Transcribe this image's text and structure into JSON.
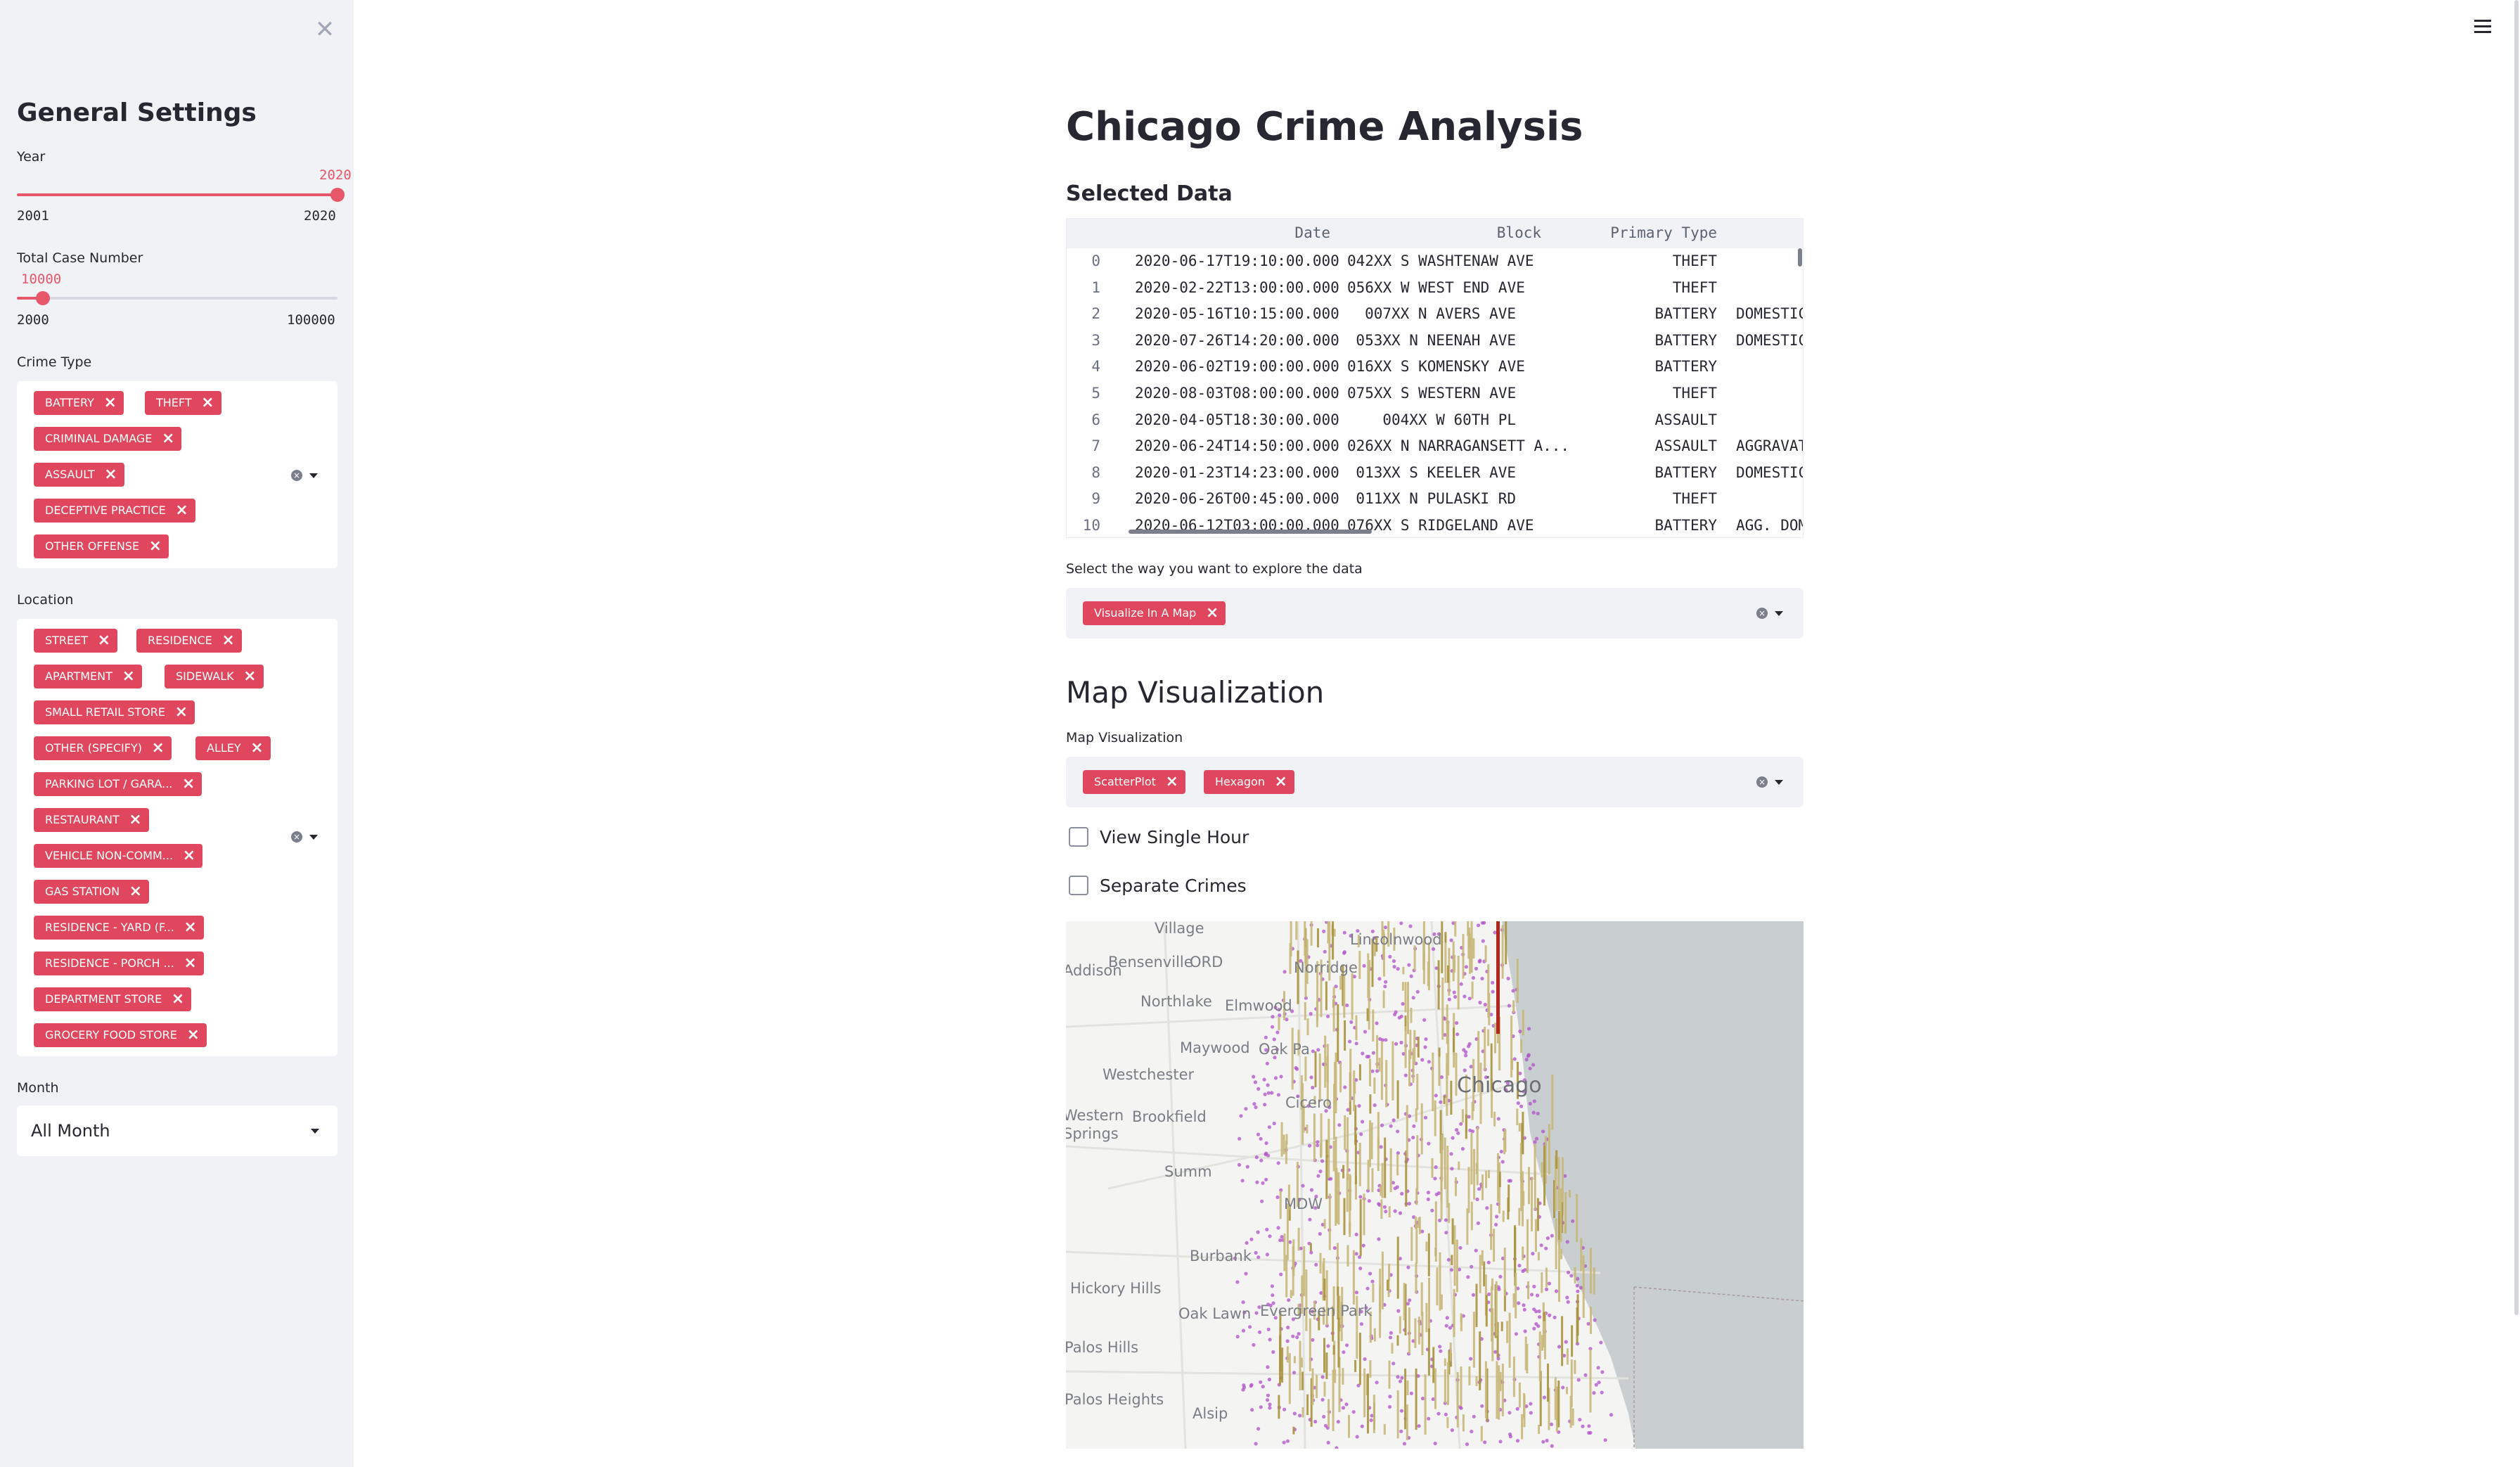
{
  "sidebar": {
    "title": "General Settings",
    "year": {
      "label": "Year",
      "value": "2020",
      "min": "2001",
      "max": "2020",
      "fraction": 1.0
    },
    "total_case": {
      "label": "Total Case Number",
      "value": "10000",
      "min": "2000",
      "max": "100000",
      "fraction": 0.082
    },
    "crime_type": {
      "label": "Crime Type",
      "options": [
        "BATTERY",
        "THEFT",
        "CRIMINAL DAMAGE",
        "ASSAULT",
        "DECEPTIVE PRACTICE",
        "OTHER OFFENSE"
      ]
    },
    "location": {
      "label": "Location",
      "options": [
        "STREET",
        "RESIDENCE",
        "APARTMENT",
        "SIDEWALK",
        "SMALL RETAIL STORE",
        "OTHER (SPECIFY)",
        "ALLEY",
        "PARKING LOT / GARA...",
        "RESTAURANT",
        "VEHICLE NON-COMM...",
        "GAS STATION",
        "RESIDENCE - YARD (F...",
        "RESIDENCE - PORCH ...",
        "DEPARTMENT STORE",
        "GROCERY FOOD STORE"
      ]
    },
    "month": {
      "label": "Month",
      "value": "All Month"
    }
  },
  "main": {
    "title": "Chicago Crime Analysis",
    "selected_title": "Selected Data",
    "table": {
      "columns": [
        "Date",
        "Block",
        "Primary Type"
      ],
      "rows": [
        {
          "i": "0",
          "date": "2020-06-17T19:10:00.000",
          "block": "042XX S WASHTENAW AVE",
          "type": "THEFT",
          "extra": ""
        },
        {
          "i": "1",
          "date": "2020-02-22T13:00:00.000",
          "block": "056XX W WEST END AVE",
          "type": "THEFT",
          "extra": ""
        },
        {
          "i": "2",
          "date": "2020-05-16T10:15:00.000",
          "block": "007XX N AVERS AVE",
          "type": "BATTERY",
          "extra": "DOMESTIC"
        },
        {
          "i": "3",
          "date": "2020-07-26T14:20:00.000",
          "block": "053XX N NEENAH AVE",
          "type": "BATTERY",
          "extra": "DOMESTIC"
        },
        {
          "i": "4",
          "date": "2020-06-02T19:00:00.000",
          "block": "016XX S KOMENSKY AVE",
          "type": "BATTERY",
          "extra": ""
        },
        {
          "i": "5",
          "date": "2020-08-03T08:00:00.000",
          "block": "075XX S WESTERN AVE",
          "type": "THEFT",
          "extra": ""
        },
        {
          "i": "6",
          "date": "2020-04-05T18:30:00.000",
          "block": "004XX W 60TH PL",
          "type": "ASSAULT",
          "extra": ""
        },
        {
          "i": "7",
          "date": "2020-06-24T14:50:00.000",
          "block": "026XX N NARRAGANSETT A...",
          "type": "ASSAULT",
          "extra": "AGGRAVAT"
        },
        {
          "i": "8",
          "date": "2020-01-23T14:23:00.000",
          "block": "013XX S KEELER AVE",
          "type": "BATTERY",
          "extra": "DOMESTIC"
        },
        {
          "i": "9",
          "date": "2020-06-26T00:45:00.000",
          "block": "011XX N PULASKI RD",
          "type": "THEFT",
          "extra": ""
        },
        {
          "i": "10",
          "date": "2020-06-12T03:00:00.000",
          "block": "076XX S RIDGELAND AVE",
          "type": "BATTERY",
          "extra": "AGG. DOM"
        }
      ]
    },
    "explore_label": "Select the way you want to explore the data",
    "explore_options": [
      "Visualize In A Map"
    ],
    "map_heading": "Map Visualization",
    "map_label": "Map Visualization",
    "map_options": [
      "ScatterPlot",
      "Hexagon"
    ],
    "checkboxes": [
      {
        "label": "View Single Hour",
        "checked": false
      },
      {
        "label": "Separate Crimes",
        "checked": false
      }
    ],
    "map_places": [
      "Village",
      "Bensenville",
      "Lincolnwood",
      "ORD",
      "Norridge",
      "Addison",
      "Northlake",
      "Elmwood",
      "Maywood",
      "Oak Pa",
      "Westchester",
      "Chicago",
      "Cicero",
      "Brookfield",
      "Western",
      "Springs",
      "Summ",
      "MDW",
      "Burbank",
      "Hickory Hills",
      "Oak Lawn",
      "Evergreen Park",
      "Palos Hills",
      "Palos Heights",
      "Alsip"
    ]
  },
  "colors": {
    "accent": "#e0475f",
    "slider": "#e8566a",
    "sidebar_bg": "#f0f2f6",
    "water": "#c9ced1",
    "land": "#f4f4f2",
    "column": "#c8b87a",
    "scatter": "#b050c8"
  },
  "icons": [
    "close-icon",
    "hamburger-menu-icon",
    "clear-icon",
    "chevron-down-icon",
    "chip-remove-icon"
  ]
}
